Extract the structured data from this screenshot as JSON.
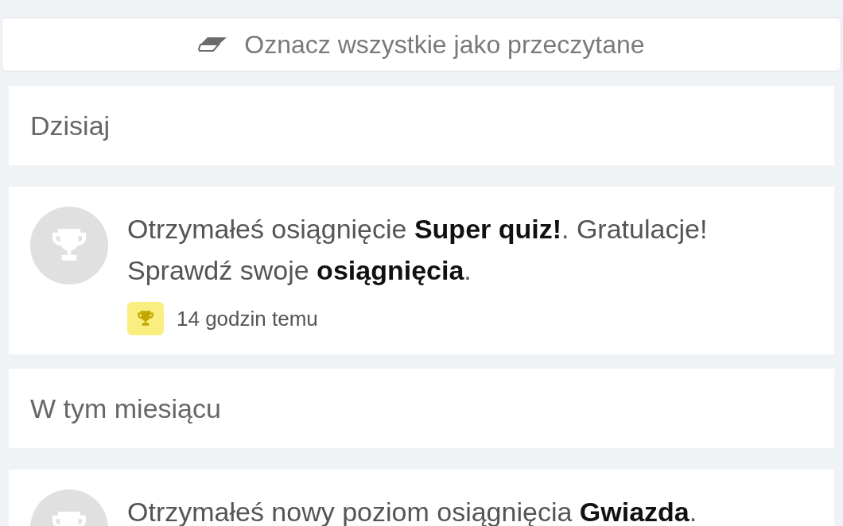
{
  "mark_all_button": {
    "label": "Oznacz wszystkie jako przeczytane"
  },
  "sections": [
    {
      "title": "Dzisiaj",
      "notifications": [
        {
          "text": "Otrzymałeś osiągnięcie **Super quiz!**. Gratulacje! Sprawdź swoje **osiągnięcia**.",
          "time": "14 godzin temu"
        }
      ]
    },
    {
      "title": "W tym miesiącu",
      "notifications": [
        {
          "text": "Otrzymałeś nowy poziom osiągnięcia **Gwiazda**."
        }
      ]
    }
  ]
}
